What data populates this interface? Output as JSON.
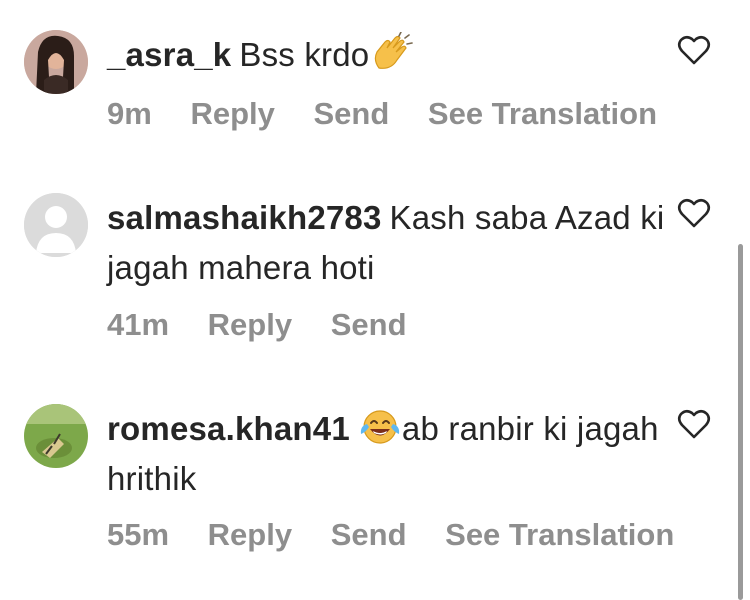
{
  "comments": [
    {
      "username": "_asra_k",
      "text": "Bss krdo",
      "emoji": "clapping-hands",
      "time": "9m",
      "actions": {
        "reply": "Reply",
        "send": "Send",
        "translate": "See Translation"
      }
    },
    {
      "username": "salmashaikh2783",
      "text": "Kash saba Azad ki jagah mahera hoti",
      "time": "41m",
      "actions": {
        "reply": "Reply",
        "send": "Send"
      }
    },
    {
      "username": "romesa.khan41",
      "emoji": "face-with-tears-of-joy",
      "text": "ab ranbir ki jagah hrithik",
      "time": "55m",
      "actions": {
        "reply": "Reply",
        "send": "Send",
        "translate": "See Translation"
      }
    }
  ],
  "icons": {
    "like": "heart-outline-icon"
  },
  "colors": {
    "text": "#262626",
    "secondary": "#8e8e8e"
  }
}
